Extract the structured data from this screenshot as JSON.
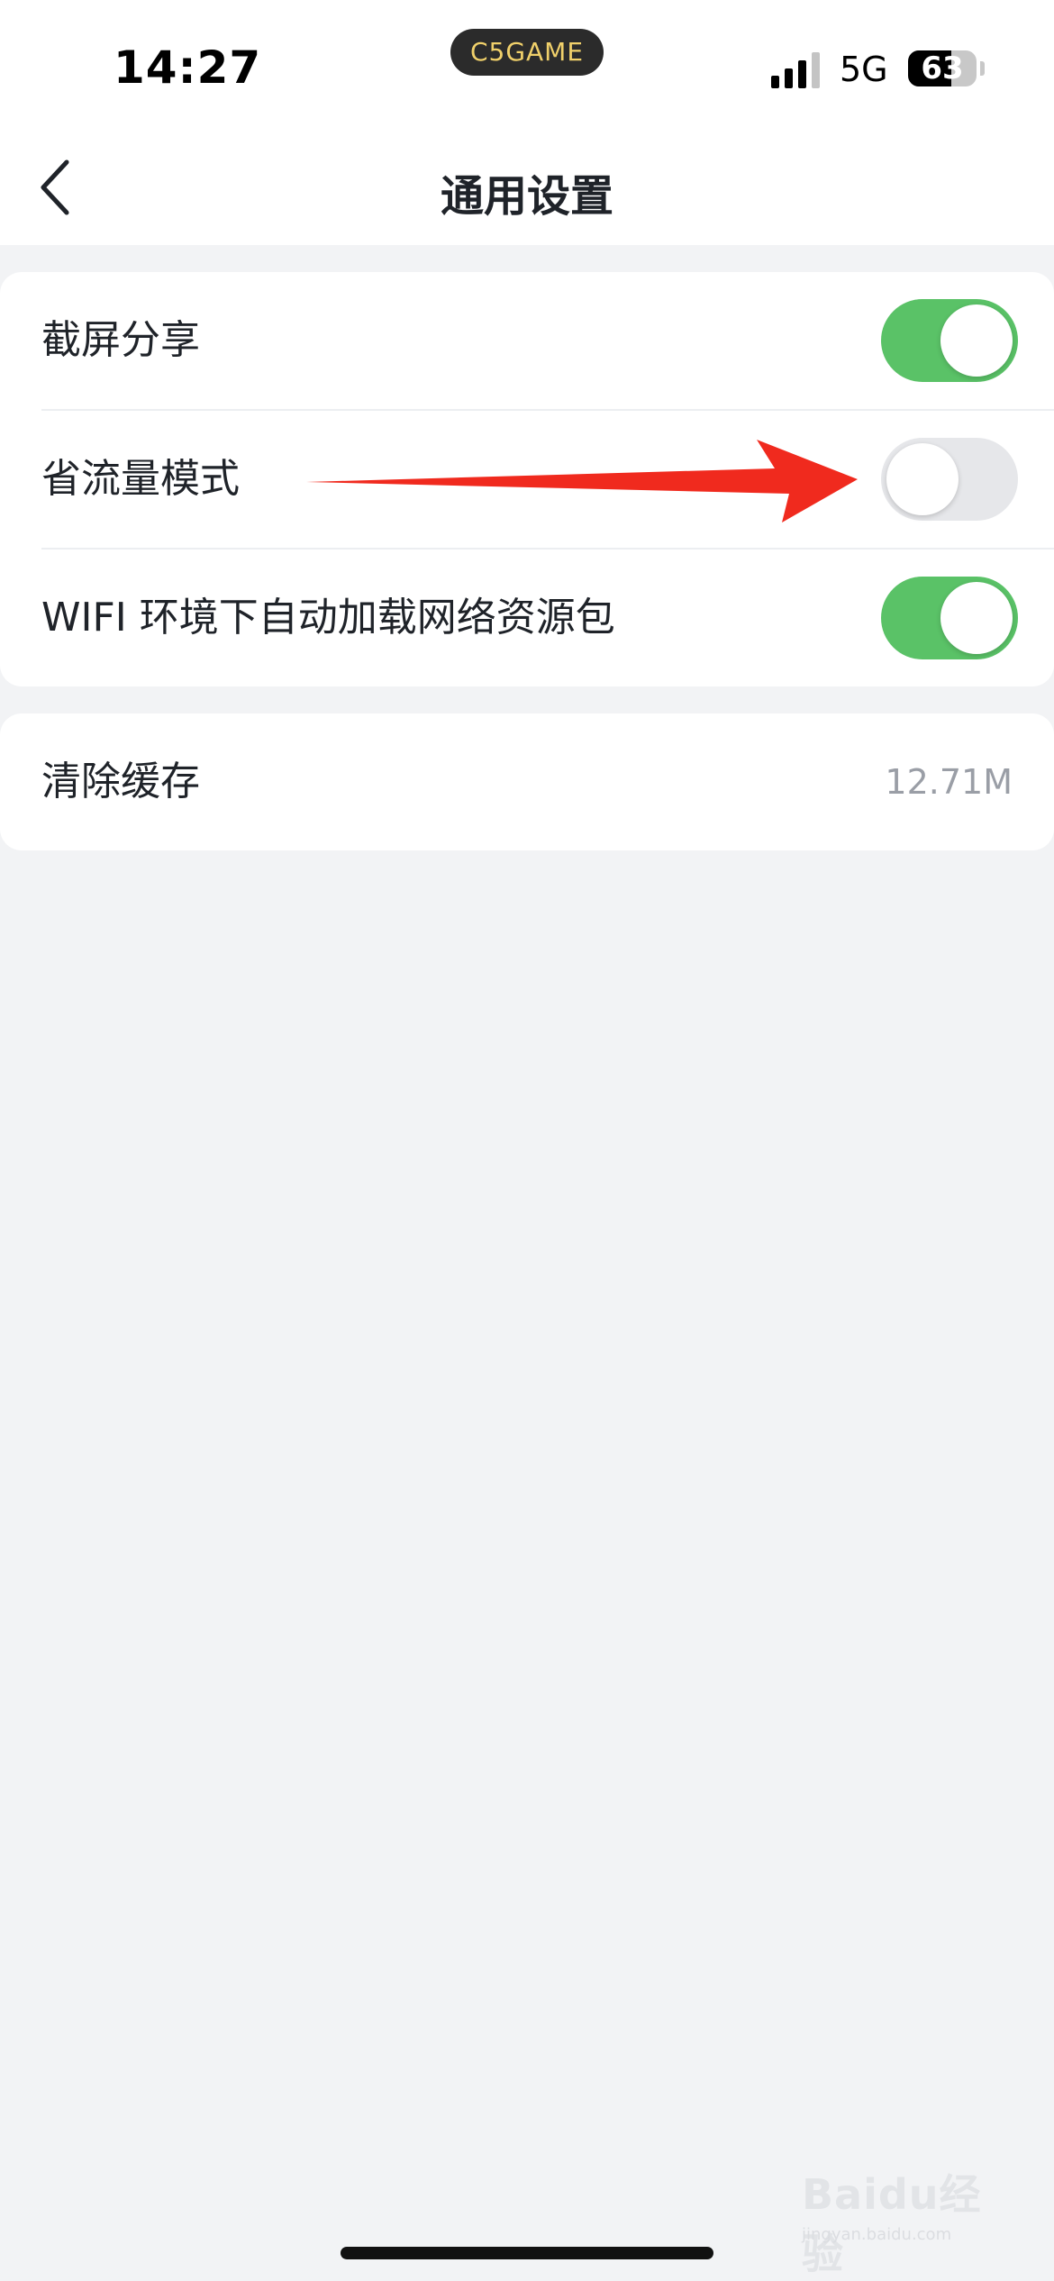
{
  "status_bar": {
    "time": "14:27",
    "island_label": "C5GAME",
    "network": "5G",
    "battery_percent": 63,
    "battery_text": "63"
  },
  "nav": {
    "title": "通用设置",
    "back_icon": "chevron-left-icon"
  },
  "settings": {
    "screenshot_share": {
      "label": "截屏分享",
      "enabled": true
    },
    "data_saver": {
      "label": "省流量模式",
      "enabled": false
    },
    "wifi_autoload": {
      "label": "WIFI 环境下自动加载网络资源包",
      "enabled": true
    },
    "clear_cache": {
      "label": "清除缓存",
      "value": "12.71M"
    }
  },
  "annotation": {
    "arrow_color": "#f02a1e"
  },
  "watermark": {
    "brand": "Baidu经验",
    "url": "jingyan.baidu.com"
  },
  "colors": {
    "toggle_on": "#5ac267",
    "toggle_off": "#e6e7ea",
    "page_background": "#f2f3f5"
  }
}
